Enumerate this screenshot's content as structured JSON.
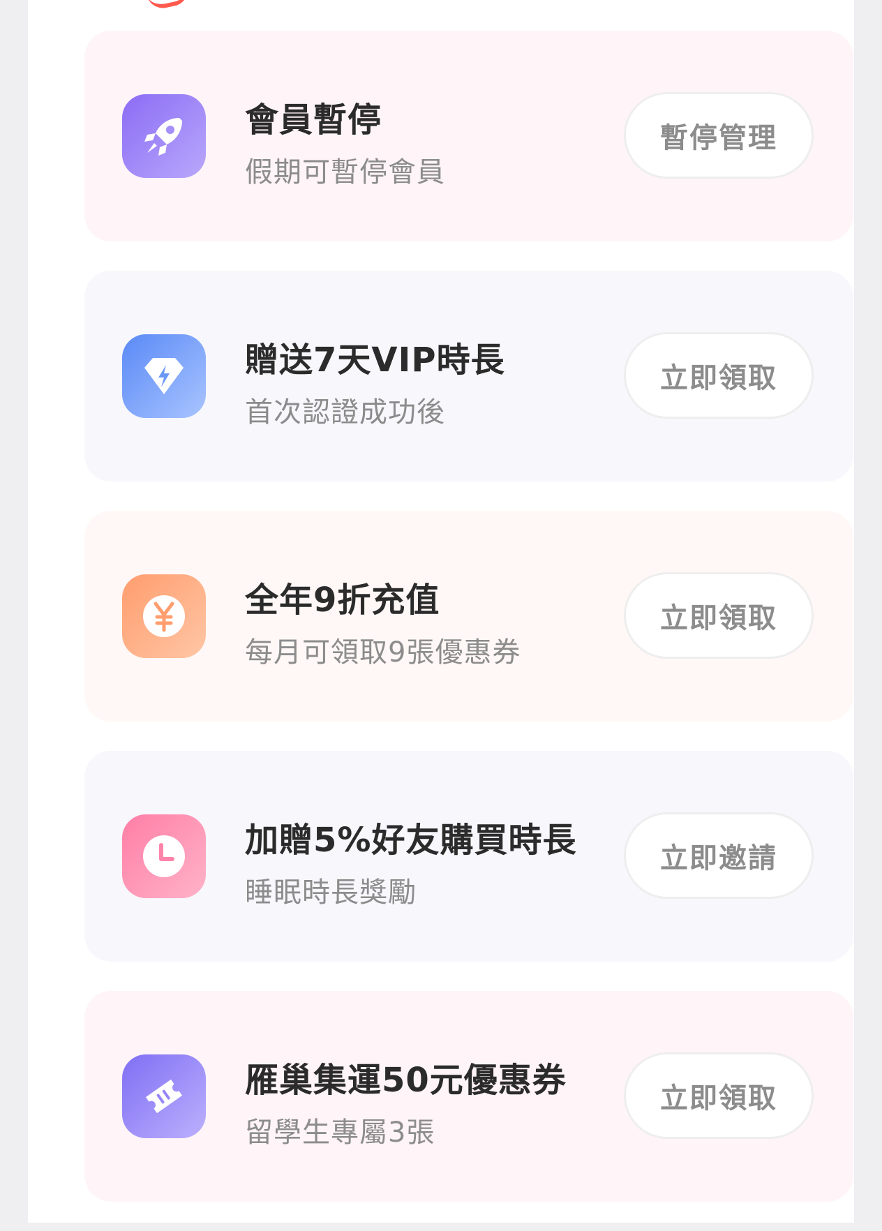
{
  "colors": {
    "page_background": "#efeff2",
    "panel_background": "#ffffff",
    "title_text": "#2b2b2b",
    "subtitle_text": "#8c8c8c",
    "button_text": "#8c8c8c",
    "accent_red": "#ff5a4e"
  },
  "benefits": [
    {
      "icon": "rocket-icon",
      "icon_color": "#8b6cf5",
      "card_color": "#fff4f7",
      "title": "會員暫停",
      "subtitle": "假期可暫停會員",
      "button_label": "暫停管理"
    },
    {
      "icon": "diamond-lightning-icon",
      "icon_color": "#5a8af6",
      "card_color": "#f7f7fc",
      "title": "贈送7天VIP時長",
      "subtitle": "首次認證成功後",
      "button_label": "立即領取"
    },
    {
      "icon": "yen-coin-icon",
      "icon_color": "#ff9d6e",
      "card_color": "#fff8f6",
      "title": "全年9折充值",
      "subtitle": "每月可領取9張優惠券",
      "button_label": "立即領取"
    },
    {
      "icon": "clock-icon",
      "icon_color": "#ff7ea6",
      "card_color": "#f7f7fc",
      "title": "加贈5%好友購買時長",
      "subtitle": "睡眠時長獎勵",
      "button_label": "立即邀請"
    },
    {
      "icon": "ticket-icon",
      "icon_color": "#7f6ff4",
      "card_color": "#fff4f7",
      "title": "雁巢集運50元優惠券",
      "subtitle": "留學生專屬3張",
      "button_label": "立即領取"
    }
  ]
}
